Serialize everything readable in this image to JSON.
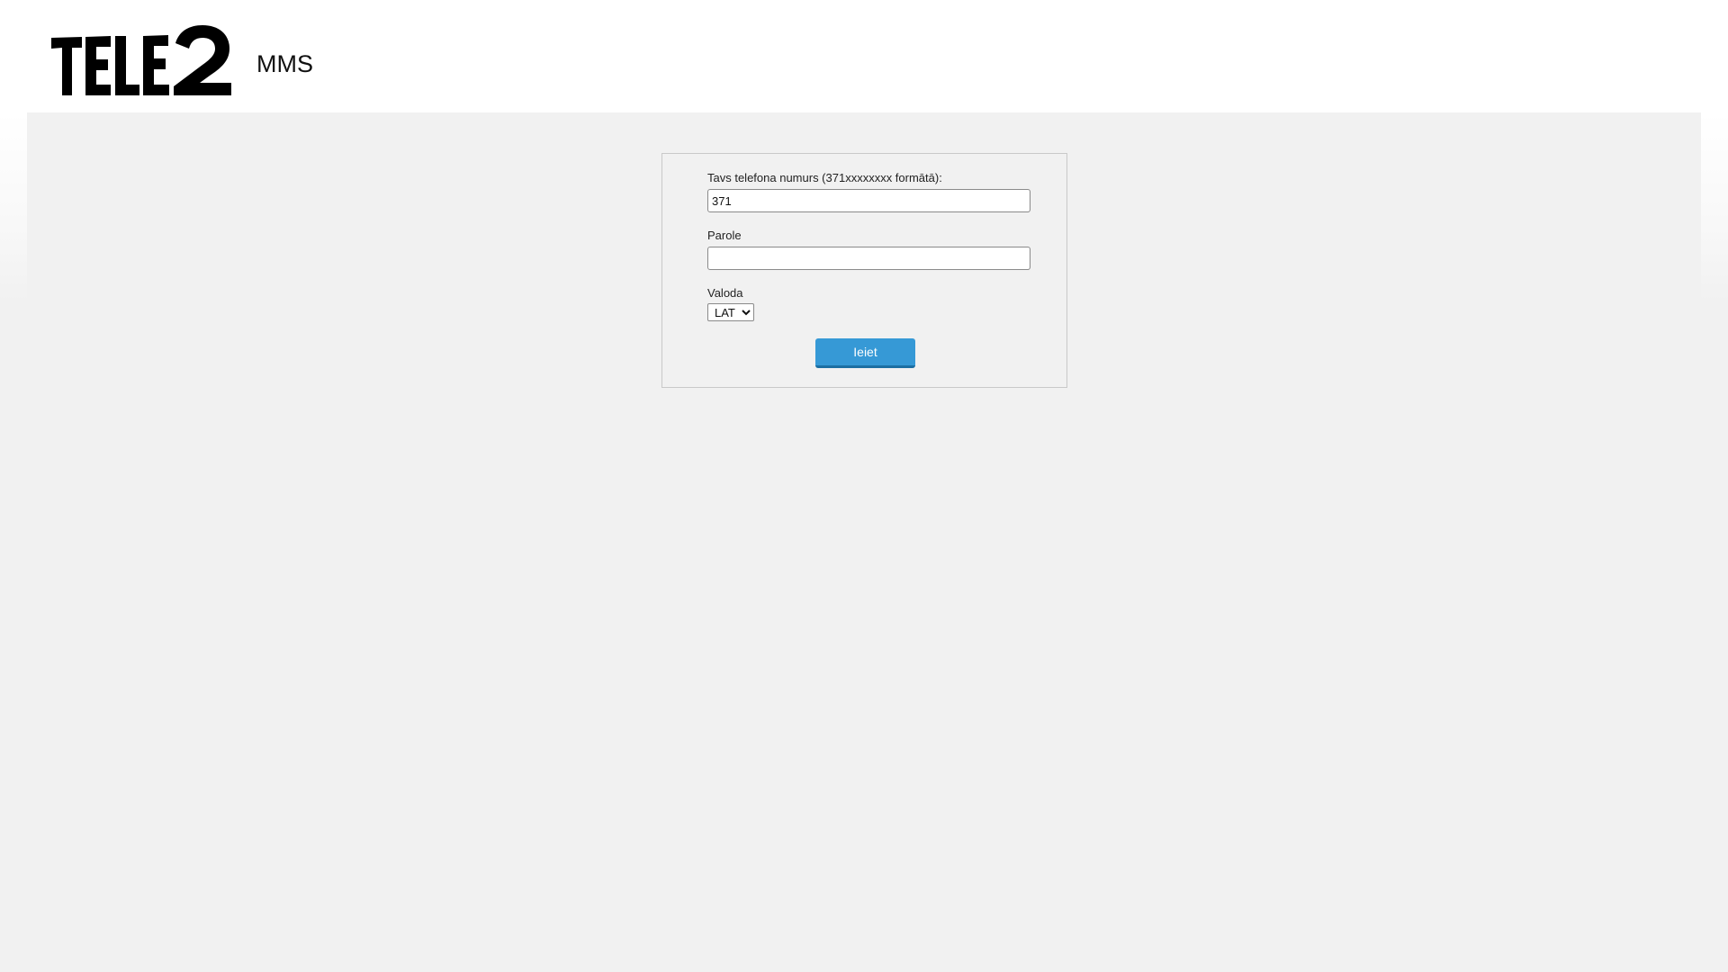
{
  "header": {
    "logo_text": "TELE2",
    "app_name": "MMS"
  },
  "login_form": {
    "phone_label": "Tavs telefona numurs (371xxxxxxxx formātā):",
    "phone_value": "371",
    "password_label": "Parole",
    "password_value": "",
    "language_label": "Valoda",
    "language_selected": "LAT",
    "submit_label": "Ieiet"
  },
  "colors": {
    "page_background": "#f1f1f1",
    "header_background": "#ffffff",
    "button_background": "#3699d6",
    "button_border_bottom": "#1c6fa3",
    "box_border": "#c9c9c9"
  }
}
